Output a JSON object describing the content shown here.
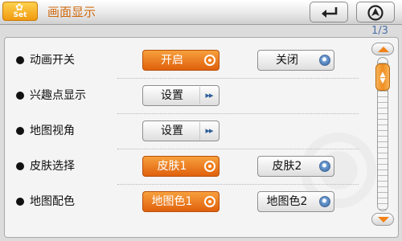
{
  "header": {
    "badge_label": "Set",
    "badge_icon": "gear-icon",
    "title": "画面显示",
    "back_icon": "return-arrow-icon",
    "home_icon": "navigation-home-icon"
  },
  "page_indicator": "1/3",
  "rows": [
    {
      "label": "动画开关",
      "type": "radio",
      "options": [
        {
          "label": "开启",
          "selected": true
        },
        {
          "label": "关闭",
          "selected": false
        }
      ]
    },
    {
      "label": "兴趣点显示",
      "type": "nav",
      "button_label": "设置"
    },
    {
      "label": "地图视角",
      "type": "nav",
      "button_label": "设置"
    },
    {
      "label": "皮肤选择",
      "type": "radio",
      "options": [
        {
          "label": "皮肤1",
          "selected": true
        },
        {
          "label": "皮肤2",
          "selected": false
        }
      ]
    },
    {
      "label": "地图配色",
      "type": "radio",
      "options": [
        {
          "label": "地图色1",
          "selected": true
        },
        {
          "label": "地图色2",
          "selected": false
        }
      ]
    }
  ],
  "scroll_position": 0.05,
  "colors": {
    "accent": "#e8720f",
    "title_text": "#cf6a10",
    "indicator_text": "#4b73a8",
    "selected_radio": "#f07a15",
    "unselected_radio": "#2f5f9a"
  }
}
